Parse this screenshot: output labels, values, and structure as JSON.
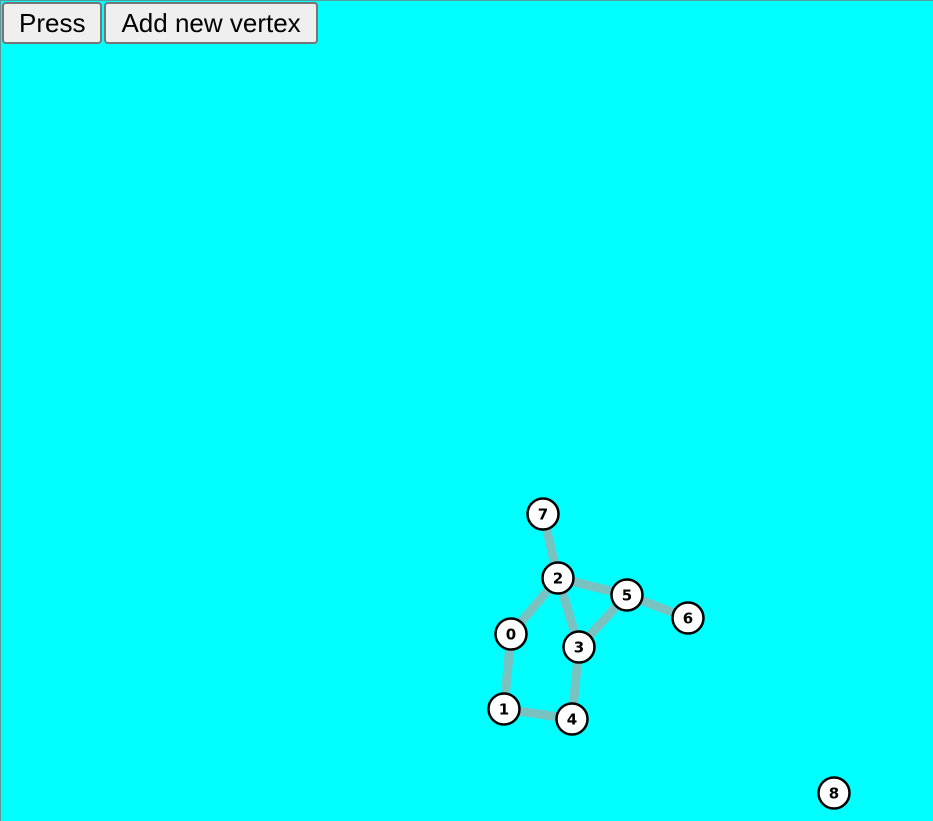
{
  "toolbar": {
    "press_label": "Press",
    "add_vertex_label": "Add new vertex"
  },
  "colors": {
    "canvas_background": "#00ffff",
    "edge": "#79c2c2",
    "vertex_fill": "#ffffff",
    "vertex_stroke": "#000000"
  },
  "graph": {
    "vertices": [
      {
        "id": "0",
        "label": "0"
      },
      {
        "id": "1",
        "label": "1"
      },
      {
        "id": "2",
        "label": "2"
      },
      {
        "id": "3",
        "label": "3"
      },
      {
        "id": "4",
        "label": "4"
      },
      {
        "id": "5",
        "label": "5"
      },
      {
        "id": "6",
        "label": "6"
      },
      {
        "id": "7",
        "label": "7"
      },
      {
        "id": "8",
        "label": "8"
      }
    ],
    "edges": [
      [
        "7",
        "2"
      ],
      [
        "2",
        "0"
      ],
      [
        "2",
        "3"
      ],
      [
        "2",
        "5"
      ],
      [
        "5",
        "3"
      ],
      [
        "5",
        "6"
      ],
      [
        "0",
        "1"
      ],
      [
        "1",
        "4"
      ],
      [
        "3",
        "4"
      ]
    ]
  }
}
